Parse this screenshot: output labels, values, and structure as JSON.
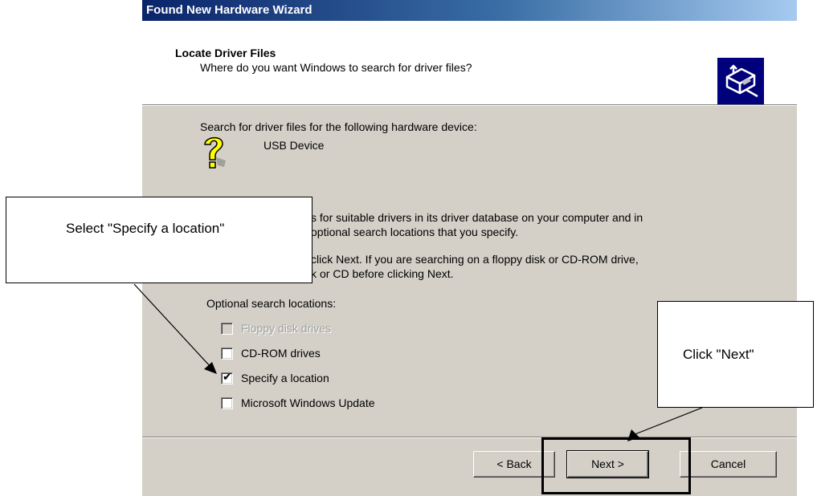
{
  "window": {
    "title": "Found New Hardware Wizard"
  },
  "header": {
    "title": "Locate Driver Files",
    "subtitle": "Where do you want Windows to search for driver files?",
    "icon": "hardware-install-icon"
  },
  "content": {
    "intro": "Search for driver files for the following hardware device:",
    "device_name": "USB Device",
    "device_icon": "question-mark-icon",
    "para1_line1": "s for suitable drivers in its driver database on your computer and in",
    "para1_line2": "optional search locations that you specify.",
    "para2_line1": "click Next. If you are searching on a floppy disk or CD-ROM drive,",
    "para2_line2": "or CD before clicking Next.",
    "para2_fragment": "k",
    "optional_label": "Optional search locations:",
    "options": [
      {
        "label": "Floppy disk drives",
        "checked": false,
        "disabled": true
      },
      {
        "label": "CD-ROM drives",
        "checked": false,
        "disabled": false
      },
      {
        "label": "Specify a location",
        "checked": true,
        "disabled": false
      },
      {
        "label": "Microsoft Windows Update",
        "checked": false,
        "disabled": false
      }
    ]
  },
  "buttons": {
    "back": "< Back",
    "next": "Next >",
    "cancel": "Cancel"
  },
  "callouts": {
    "select": "Select \"Specify a location\"",
    "next": "Click \"Next\""
  }
}
